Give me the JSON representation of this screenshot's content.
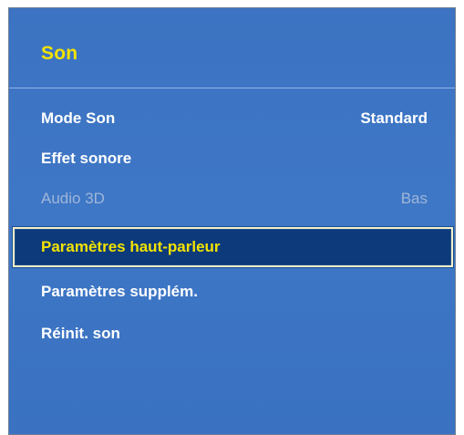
{
  "menu": {
    "title": "Son",
    "items": [
      {
        "label": "Mode Son",
        "value": "Standard",
        "state": "normal"
      },
      {
        "label": "Effet sonore",
        "value": "",
        "state": "normal"
      },
      {
        "label": "Audio 3D",
        "value": "Bas",
        "state": "disabled"
      },
      {
        "label": "Paramètres haut-parleur",
        "value": "",
        "state": "selected"
      },
      {
        "label": "Paramètres supplém.",
        "value": "",
        "state": "normal"
      },
      {
        "label": "Réinit. son",
        "value": "",
        "state": "normal"
      }
    ]
  },
  "colors": {
    "panel_background": "#3c73c2",
    "title_text": "#f3e200",
    "item_text": "#ffffff",
    "disabled_text": "#9fb6d8",
    "selected_background": "#0c3a7a",
    "selected_text": "#f3e200",
    "selected_border": "#f4f0c8"
  }
}
